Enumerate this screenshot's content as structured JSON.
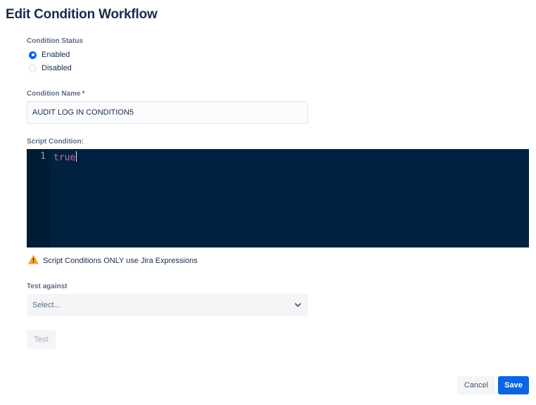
{
  "page": {
    "title": "Edit Condition Workflow"
  },
  "condition_status": {
    "label": "Condition Status",
    "options": [
      {
        "label": "Enabled",
        "checked": true
      },
      {
        "label": "Disabled",
        "checked": false
      }
    ]
  },
  "condition_name": {
    "label": "Condition Name",
    "required_mark": "*",
    "value": "AUDIT LOG IN CONDITION5"
  },
  "script_condition": {
    "label": "Script Condition:",
    "line_number": "1",
    "code": "true"
  },
  "warning": {
    "icon": "warning-icon",
    "color": "#f5a623",
    "text": "Script Conditions ONLY use Jira Expressions"
  },
  "test_against": {
    "label": "Test against",
    "placeholder": "Select..."
  },
  "buttons": {
    "test": "Test",
    "cancel": "Cancel",
    "save": "Save"
  },
  "colors": {
    "primary": "#0c66e4",
    "editor_background": "#002240",
    "code_keyword": "#e55d9e"
  }
}
